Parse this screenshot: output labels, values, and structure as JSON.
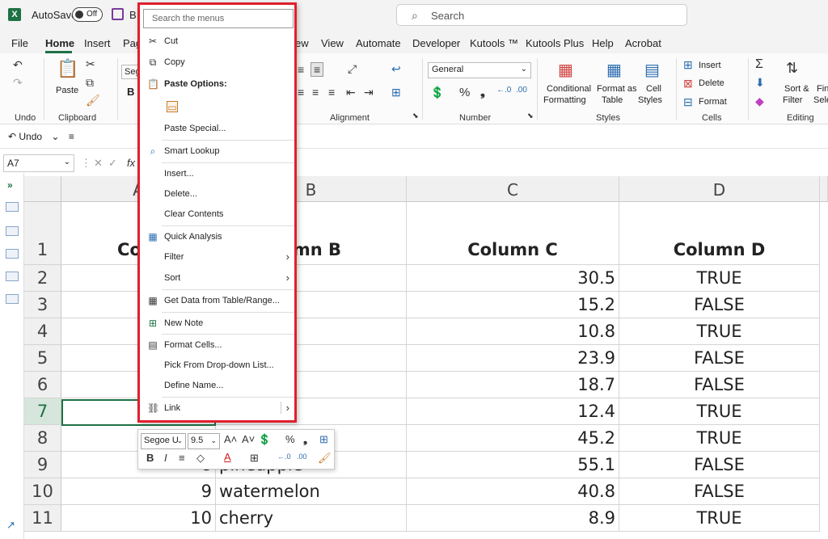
{
  "titlebar": {
    "app_icon": "excel-logo",
    "app_letter": "X",
    "autosave_label": "AutoSave",
    "autosave_state": "Off",
    "title_fragment": "B",
    "search_placeholder": "Search"
  },
  "menubar": {
    "items": [
      "File",
      "Home",
      "Insert",
      "Pag",
      "ew",
      "View",
      "Automate",
      "Developer",
      "Kutools ™",
      "Kutools Plus",
      "Help",
      "Acrobat"
    ],
    "active": "Home"
  },
  "ribbon": {
    "undo_group": "Undo",
    "clipboard_group": "Clipboard",
    "paste_label": "Paste",
    "font_box": "Sego",
    "bold_label": "B",
    "alignment_group": "Alignment",
    "number_format": "General",
    "number_group": "Number",
    "percent_symbol": "%",
    "comma_symbol": "❟",
    "cond_format_l1": "Conditional",
    "cond_format_l2": "Formatting",
    "format_table_l1": "Format as",
    "format_table_l2": "Table",
    "cell_styles_l1": "Cell",
    "cell_styles_l2": "Styles",
    "styles_group": "Styles",
    "insert_label": "Insert",
    "delete_label": "Delete",
    "format_label": "Format",
    "cells_group": "Cells",
    "sort_filter_l1": "Sort &",
    "sort_filter_l2": "Filter",
    "find_l1": "Fin",
    "find_l2": "Sele",
    "editing_group": "Editing",
    "sigma": "Σ"
  },
  "qat": {
    "undo_label": "Undo"
  },
  "formula_bar": {
    "name_box": "A7",
    "fx_label": "fx"
  },
  "grid": {
    "col_headers": [
      "A",
      "B",
      "C",
      "D"
    ],
    "row_headers": [
      "1",
      "2",
      "3",
      "4",
      "5",
      "6",
      "7",
      "8",
      "9",
      "10",
      "11"
    ],
    "headers": [
      "Colu",
      "umn B",
      "Column C",
      "Column D"
    ],
    "rows": [
      {
        "a": "",
        "b": "",
        "c": "30.5",
        "d": "TRUE"
      },
      {
        "a": "",
        "b": "",
        "c": "15.2",
        "d": "FALSE"
      },
      {
        "a": "",
        "b": "",
        "c": "10.8",
        "d": "TRUE"
      },
      {
        "a": "",
        "b": "",
        "c": "23.9",
        "d": "FALSE"
      },
      {
        "a": "",
        "b": "",
        "c": "18.7",
        "d": "FALSE"
      },
      {
        "a": "",
        "b": "",
        "c": "12.4",
        "d": "TRUE"
      },
      {
        "a": "",
        "b": "",
        "c": "45.2",
        "d": "TRUE"
      },
      {
        "a": "8",
        "b": "pineapple",
        "c": "55.1",
        "d": "FALSE"
      },
      {
        "a": "9",
        "b": "watermelon",
        "c": "40.8",
        "d": "FALSE"
      },
      {
        "a": "10",
        "b": "cherry",
        "c": "8.9",
        "d": "TRUE"
      }
    ]
  },
  "context_menu": {
    "search_placeholder": "Search the menus",
    "cut": "Cut",
    "copy": "Copy",
    "paste_options": "Paste Options:",
    "paste_special": "Paste Special...",
    "smart_lookup": "Smart Lookup",
    "insert": "Insert...",
    "delete": "Delete...",
    "clear_contents": "Clear Contents",
    "quick_analysis": "Quick Analysis",
    "filter": "Filter",
    "sort": "Sort",
    "get_data": "Get Data from Table/Range...",
    "new_note": "New Note",
    "format_cells": "Format Cells...",
    "pick_dropdown": "Pick From Drop-down List...",
    "define_name": "Define Name...",
    "link": "Link",
    "highlight_color": "#e0202e"
  },
  "mini_toolbar": {
    "font": "Segoe U",
    "size": "9.5",
    "bold": "B",
    "italic": "I",
    "percent": "%",
    "comma": "❟"
  },
  "colors": {
    "accent": "#1e7145"
  }
}
